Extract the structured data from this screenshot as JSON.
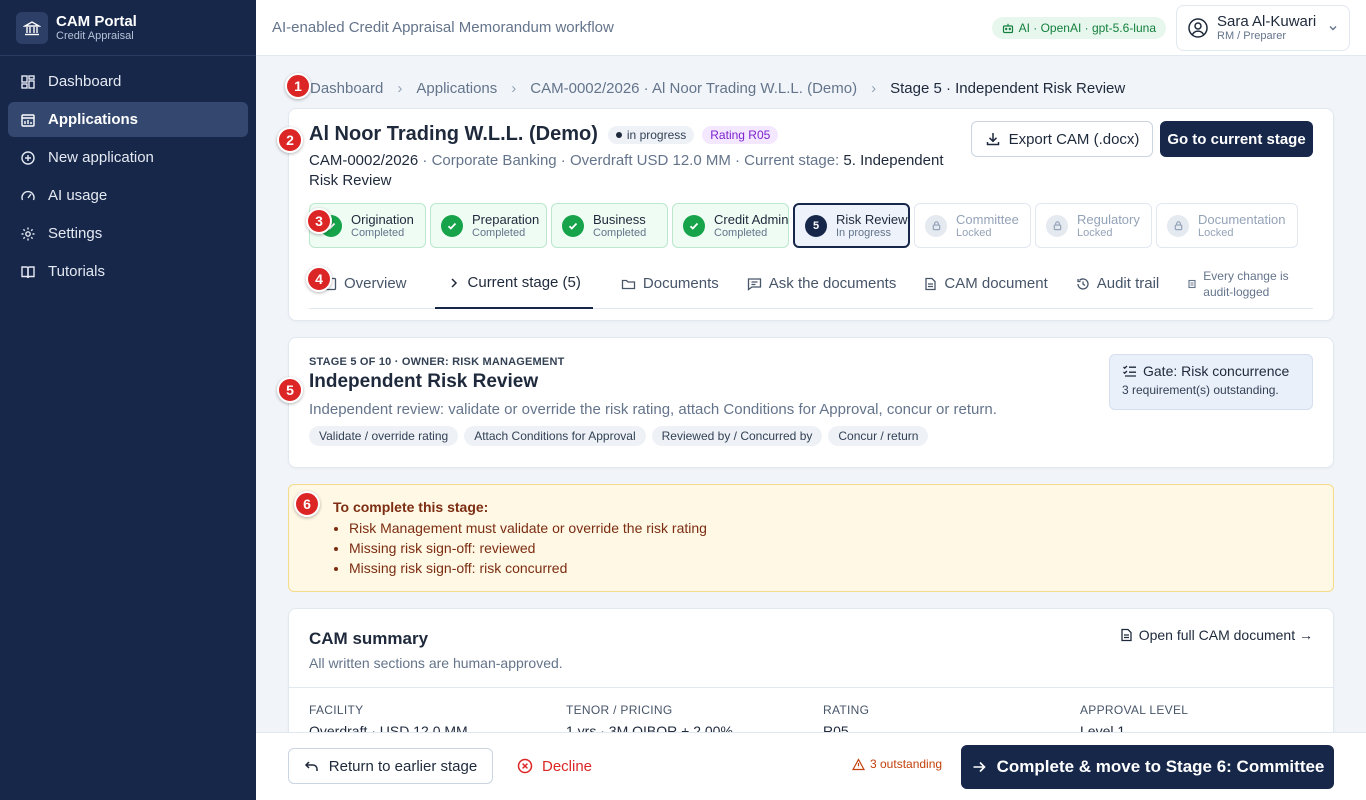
{
  "brand": {
    "title": "CAM Portal",
    "subtitle": "Credit Appraisal"
  },
  "nav": [
    {
      "label": "Dashboard",
      "icon": "dashboard-icon"
    },
    {
      "label": "Applications",
      "icon": "applications-icon"
    },
    {
      "label": "New application",
      "icon": "plus-circle-icon"
    },
    {
      "label": "AI usage",
      "icon": "gauge-icon"
    },
    {
      "label": "Settings",
      "icon": "gear-icon"
    },
    {
      "label": "Tutorials",
      "icon": "book-icon"
    }
  ],
  "topbar": {
    "title": "AI-enabled Credit Appraisal Memorandum workflow",
    "ai_badge": "AI · OpenAI · gpt-5.6-luna",
    "user_name": "Sara Al-Kuwari",
    "user_role": "RM / Preparer"
  },
  "breadcrumb": [
    "Dashboard",
    "Applications",
    "CAM-0002/2026 · Al Noor Trading W.L.L. (Demo)",
    "Stage 5 · Independent Risk Review"
  ],
  "markers": [
    "1",
    "2",
    "3",
    "4",
    "5",
    "6"
  ],
  "application": {
    "name": "Al Noor Trading W.L.L. (Demo)",
    "status": "in progress",
    "rating": "Rating R05",
    "ref": "CAM-0002/2026",
    "meta": " · Corporate Banking · Overdraft USD 12.0 MM · Current stage: ",
    "current_stage": "5. Independent Risk Review",
    "export_label": "Export CAM (.docx)",
    "goto_label": "Go to current stage"
  },
  "stages": [
    {
      "name": "Origination",
      "state": "Completed",
      "status": "done"
    },
    {
      "name": "Preparation",
      "state": "Completed",
      "status": "done"
    },
    {
      "name": "Business",
      "state": "Completed",
      "status": "done"
    },
    {
      "name": "Credit Admin",
      "state": "Completed",
      "status": "done"
    },
    {
      "name": "Risk Review",
      "state": "In progress",
      "status": "current",
      "number": "5"
    },
    {
      "name": "Committee",
      "state": "Locked",
      "status": "locked"
    },
    {
      "name": "Regulatory",
      "state": "Locked",
      "status": "locked"
    },
    {
      "name": "Documentation",
      "state": "Locked",
      "status": "locked"
    }
  ],
  "tabs": {
    "overview": "Overview",
    "current": "Current stage (5)",
    "documents": "Documents",
    "ask": "Ask the documents",
    "cam": "CAM document",
    "audit": "Audit trail",
    "note": "Every change is audit-logged"
  },
  "stage_card": {
    "eyebrow": "STAGE 5 OF 10 · OWNER: RISK MANAGEMENT",
    "title": "Independent Risk Review",
    "description": "Independent review: validate or override the risk rating, attach Conditions for Approval, concur or return.",
    "chips": [
      "Validate / override rating",
      "Attach Conditions for Approval",
      "Reviewed by / Concurred by",
      "Concur / return"
    ],
    "gate_title": "Gate: Risk concurrence",
    "gate_sub": "3 requirement(s) outstanding."
  },
  "todo": {
    "title": "To complete this stage:",
    "items": [
      "Risk Management must validate or override the risk rating",
      "Missing risk sign-off: reviewed",
      "Missing risk sign-off: risk concurred"
    ]
  },
  "summary": {
    "title": "CAM summary",
    "subtitle": "All written sections are human-approved.",
    "open_link": "Open full CAM document →",
    "cols": [
      {
        "label": "FACILITY",
        "value": "Overdraft · USD 12.0 MM"
      },
      {
        "label": "TENOR / PRICING",
        "value": "1 yrs · 3M QIBOR + 2.00%"
      },
      {
        "label": "RATING",
        "value": "R05"
      },
      {
        "label": "APPROVAL LEVEL",
        "value": "Level 1"
      }
    ]
  },
  "footer": {
    "return_label": "Return to earlier stage",
    "decline_label": "Decline",
    "outstanding": "3 outstanding",
    "complete_label": "Complete & move to Stage 6: Committee"
  },
  "colors": {
    "sidebar": "#16274a",
    "accent": "#16274a",
    "success": "#16a34a",
    "danger": "#dc2626",
    "warning_bg": "#fef8e4"
  }
}
